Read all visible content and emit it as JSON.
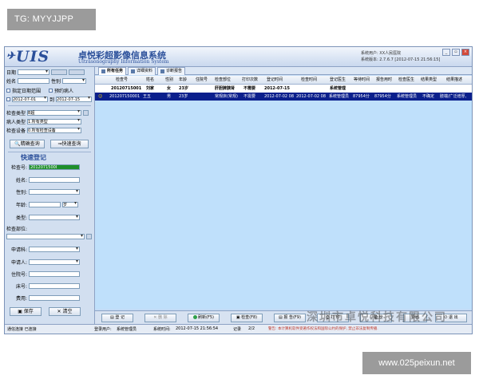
{
  "tag": "TG: MYYJJPP",
  "watermark": "www.025peixun.net",
  "app": {
    "logo": "UIS",
    "title_cn": "卓悦彩超影像信息系统",
    "title_en": "Ultrasonography Information System",
    "sys_user_label": "系统用户:",
    "sys_user": "XX人民医院",
    "sys_version_label": "系统版本:",
    "sys_version": "2.7.6.7 [2012-07-15 21:56:15]"
  },
  "left": {
    "date_label": "日期",
    "name_label": "姓名",
    "gender_label": "性别",
    "opt_date_range": "指定日期范围",
    "opt_reserved": "预约病人",
    "date_from": "2012-07-01",
    "date_to_label": "到",
    "date_to": "2012-07-15",
    "exam_type_label": "检查类型",
    "exam_type": "B超",
    "patient_type_label": "病人类型",
    "patient_type": "1.所有类型",
    "device_label": "检查设备",
    "device": "0.所有检查设备",
    "btn_exact": "精确查询",
    "btn_fast": "快速查询",
    "quick_title": "快速登记",
    "fields": {
      "exam_no": "检查号:",
      "exam_no_value": "2012071500I",
      "name": "姓名:",
      "gender": "性别:",
      "age": "年龄:",
      "age_unit": "岁",
      "type": "类型:",
      "part": "检查部位:",
      "applicant_dept": "申请科:",
      "applicant_doc": "申请人:",
      "inpatient_no": "住院号:",
      "bed_no": "床号:",
      "fee": "费用:"
    },
    "btn_save": "保存",
    "btn_clear": "清空"
  },
  "main": {
    "tabs": [
      "所有任务",
      "详细资料",
      "诊断报告"
    ],
    "columns": [
      "检查号",
      "姓名",
      "性别",
      "年龄",
      "住院号",
      "检查部位",
      "打印次数",
      "登记时间",
      "检查时间",
      "登记医生",
      "等待时间",
      "报告用时",
      "检查医生",
      "结果类型",
      "结果描述"
    ],
    "rows": [
      [
        "20120715001",
        "刘家",
        "女",
        "23岁",
        "",
        "肝胆脾胰肾",
        "不需要",
        "2012-07-15",
        "",
        "系统管理",
        "",
        "",
        "",
        "",
        ""
      ],
      [
        "201207150001",
        "王五",
        "男",
        "23岁",
        "",
        "常规床(常规)",
        "不需要",
        "2012-07-02 08",
        "2012-07-02 08",
        "系统管理员",
        "87954分",
        "87954分",
        "系统管理员",
        "不确定",
        "肢端/广泛增厚,"
      ]
    ],
    "bottom_buttons": [
      "登 记",
      "删 除",
      "刷新(F5)",
      "检查(F8)",
      "报 告(F9)",
      "打 印",
      "备 份",
      "导出",
      "退 出"
    ],
    "company": "深圳市卓悦科技有限公司"
  },
  "status": {
    "conn": "通信连接 已连接",
    "login_label": "登录用户:",
    "login": "系统管理员",
    "time_label": "系统时间:",
    "time": "2012-07-15 21:56:54",
    "record_label": "记录",
    "record": "2/2",
    "warning": "警告: 本计算机软件受著作权法和国际公约的保护, 禁止非法复制传播."
  }
}
